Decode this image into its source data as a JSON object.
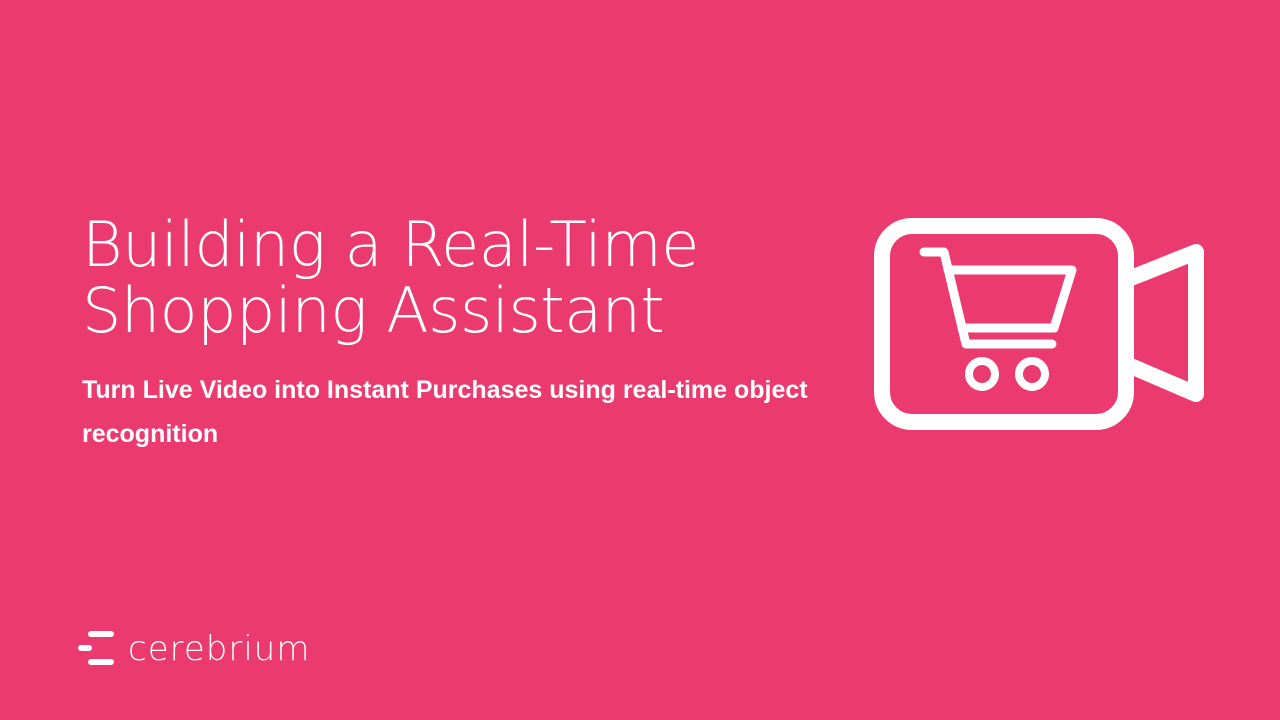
{
  "slide": {
    "background_color": "#EA3A6F",
    "title_lines": [
      "Building a Real-Time",
      "Shopping Assistant"
    ],
    "subtitle": "Turn Live Video into Instant Purchases using real-time object recognition",
    "hero_icon": "video-camera-shopping-cart-icon"
  },
  "brand": {
    "name": "cerebrium",
    "logo_icon": "cerebrium-logo-icon"
  }
}
